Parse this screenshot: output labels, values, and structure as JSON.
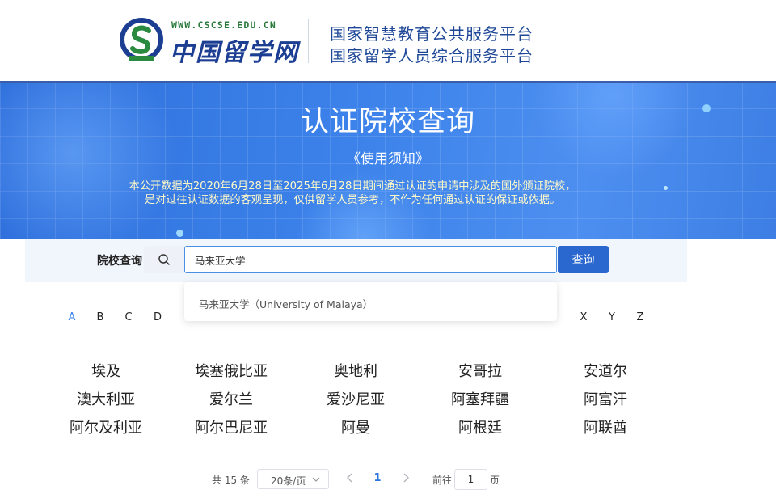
{
  "header": {
    "logo_url": "WWW.CSCSE.EDU.CN",
    "logo_name": "中国留学网",
    "line1": "国家智慧教育公共服务平台",
    "line2": "国家留学人员综合服务平台",
    "brand_color": "#1e4897"
  },
  "banner": {
    "title": "认证院校查询",
    "notice_link": "《使用须知》",
    "desc_line1": "本公开数据为2020年6月28日至2025年6月28日期间通过认证的申请中涉及的国外颁证院校，",
    "desc_line2": "是对过往认证数据的客观呈现，仅供留学人员参考，不作为任何通过认证的保证或依据。"
  },
  "search": {
    "label": "院校查询",
    "value": "马来亚大学",
    "button_label": "查询",
    "suggestion": "马来亚大学（University of Malaya）",
    "accent": "#2a67cf"
  },
  "letters": {
    "items": [
      "A",
      "B",
      "C",
      "D",
      "X",
      "Y",
      "Z"
    ],
    "active": "A"
  },
  "countries": [
    "埃及",
    "埃塞俄比亚",
    "奥地利",
    "安哥拉",
    "安道尔",
    "澳大利亚",
    "爱尔兰",
    "爱沙尼亚",
    "阿塞拜疆",
    "阿富汗",
    "阿尔及利亚",
    "阿尔巴尼亚",
    "阿曼",
    "阿根廷",
    "阿联酋"
  ],
  "pagination": {
    "total": "共 15 条",
    "page_size": "20条/页",
    "current_page": "1",
    "goto_label": "前往",
    "goto_value": "1",
    "goto_unit": "页"
  }
}
